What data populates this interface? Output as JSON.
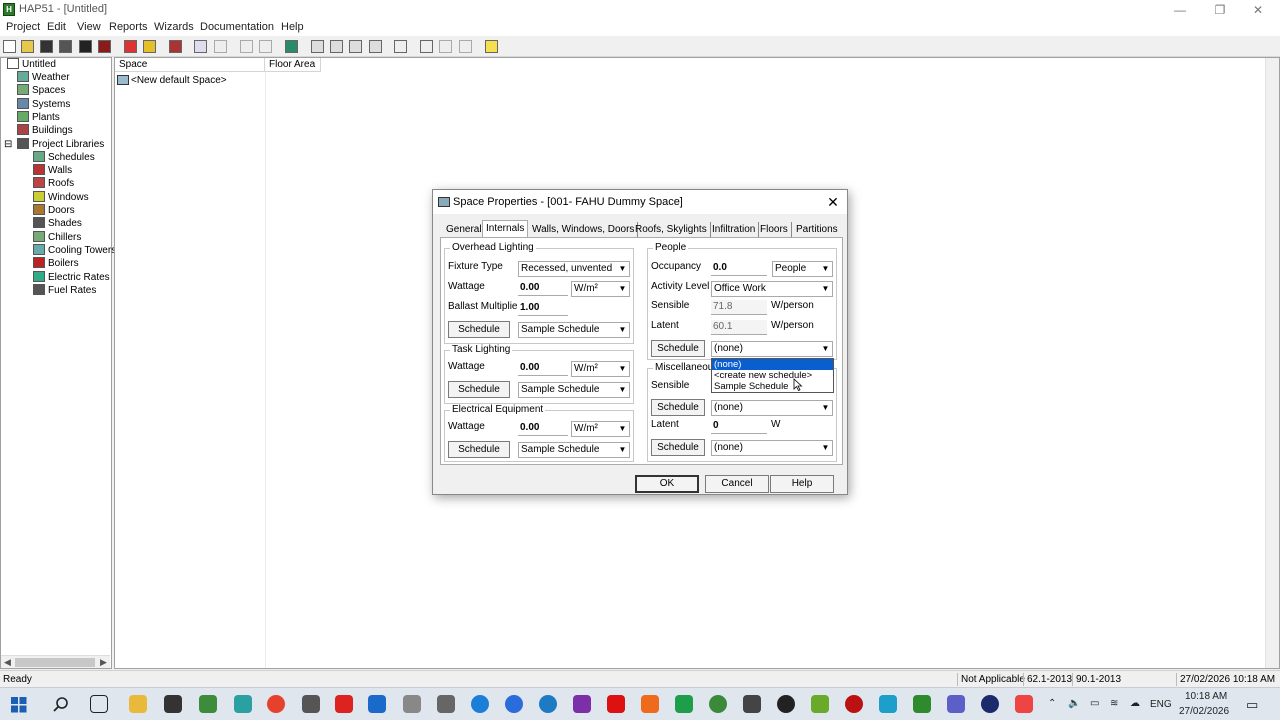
{
  "window": {
    "title": "HAP51 - [Untitled]",
    "app_icon": "H"
  },
  "menu": [
    "Project",
    "Edit",
    "View",
    "Reports",
    "Wizards",
    "Documentation",
    "Help"
  ],
  "tree": {
    "root": "Untitled",
    "items": [
      {
        "label": "Weather",
        "icon": "weather-icon"
      },
      {
        "label": "Spaces",
        "icon": "spaces-icon"
      },
      {
        "label": "Systems",
        "icon": "systems-icon"
      },
      {
        "label": "Plants",
        "icon": "plants-icon"
      },
      {
        "label": "Buildings",
        "icon": "buildings-icon"
      },
      {
        "label": "Project Libraries",
        "icon": "library-icon"
      },
      {
        "label": "Schedules",
        "icon": "schedules-icon"
      },
      {
        "label": "Walls",
        "icon": "walls-icon"
      },
      {
        "label": "Roofs",
        "icon": "roofs-icon"
      },
      {
        "label": "Windows",
        "icon": "windows-icon"
      },
      {
        "label": "Doors",
        "icon": "doors-icon"
      },
      {
        "label": "Shades",
        "icon": "shades-icon"
      },
      {
        "label": "Chillers",
        "icon": "chillers-icon"
      },
      {
        "label": "Cooling Towers",
        "icon": "cooling-towers-icon"
      },
      {
        "label": "Boilers",
        "icon": "boilers-icon"
      },
      {
        "label": "Electric Rates",
        "icon": "electric-rates-icon"
      },
      {
        "label": "Fuel Rates",
        "icon": "fuel-rates-icon"
      }
    ]
  },
  "list": {
    "columns": [
      "Space",
      "Floor Area"
    ],
    "rows": [
      "<New default Space>"
    ]
  },
  "dialog": {
    "title": "Space Properties - [001- FAHU Dummy Space]",
    "tabs": [
      "General",
      "Internals",
      "Walls, Windows, Doors",
      "Roofs, Skylights",
      "Infiltration",
      "Floors",
      "Partitions"
    ],
    "overhead": {
      "title": "Overhead Lighting",
      "fixture_label": "Fixture Type",
      "fixture_value": "Recessed, unvented",
      "wattage_label": "Wattage",
      "wattage_value": "0.00",
      "wattage_unit": "W/m²",
      "ballast_label": "Ballast Multiplier",
      "ballast_value": "1.00",
      "schedule_btn": "Schedule",
      "schedule_value": "Sample Schedule"
    },
    "task": {
      "title": "Task Lighting",
      "wattage_label": "Wattage",
      "wattage_value": "0.00",
      "wattage_unit": "W/m²",
      "schedule_btn": "Schedule",
      "schedule_value": "Sample Schedule"
    },
    "electrical": {
      "title": "Electrical Equipment",
      "wattage_label": "Wattage",
      "wattage_value": "0.00",
      "wattage_unit": "W/m²",
      "schedule_btn": "Schedule",
      "schedule_value": "Sample Schedule"
    },
    "people": {
      "title": "People",
      "occupancy_label": "Occupancy",
      "occupancy_value": "0.0",
      "occupancy_unit": "People",
      "activity_label": "Activity Level",
      "activity_value": "Office Work",
      "sensible_label": "Sensible",
      "sensible_value": "71.8",
      "sensible_unit": "W/person",
      "latent_label": "Latent",
      "latent_value": "60.1",
      "latent_unit": "W/person",
      "schedule_btn": "Schedule",
      "schedule_value": "(none)"
    },
    "misc": {
      "title": "Miscellaneous",
      "sensible_label": "Sensible",
      "schedule_btn": "Schedule",
      "schedule_value": "(none)",
      "latent_label": "Latent",
      "latent_value": "0",
      "latent_unit": "W",
      "schedule2_btn": "Schedule",
      "schedule2_value": "(none)"
    },
    "dropdown_options": [
      "(none)",
      "<create new schedule>",
      "Sample Schedule"
    ],
    "buttons": {
      "ok": "OK",
      "cancel": "Cancel",
      "help": "Help"
    }
  },
  "status": {
    "left": "Ready",
    "indicators": [
      "Not Applicable",
      "62.1-2013",
      "90.1-2013"
    ],
    "datetime": "27/02/2026  10:18 AM"
  },
  "taskbar": {
    "lang": "ENG",
    "time": "10:18 AM",
    "date": "27/02/2026"
  }
}
